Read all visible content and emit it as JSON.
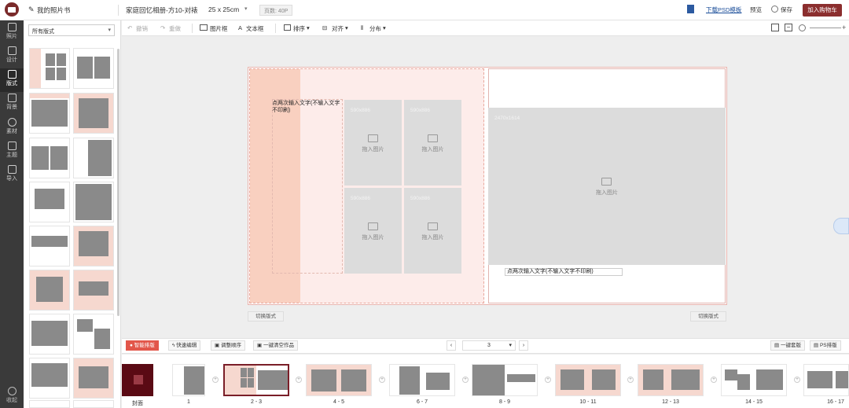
{
  "topbar": {
    "my_book": "我的照片书",
    "book_title": "家庭回忆相册-方10-对裱",
    "book_size": "25 x 25cm",
    "page_count": "页数: 40P",
    "download_psd": "下载PSD模板",
    "preview": "预览",
    "save": "保存",
    "add_to_cart": "加入购物车"
  },
  "leftnav": {
    "items": [
      "照片",
      "设计",
      "版式",
      "背景",
      "素材",
      "主题",
      "导入"
    ],
    "collapse": "收起"
  },
  "panel": {
    "filter_value": "所有版式"
  },
  "toolbar": {
    "undo": "撤销",
    "redo": "重做",
    "photo_frame": "图片框",
    "text_box": "文本框",
    "arrange": "排序",
    "align": "对齐",
    "distribute": "分布"
  },
  "canvas": {
    "left_text": "点两次输入文字(不输入文字不印刷)",
    "right_text": "点两次输入文字(不输入文字不印刷)",
    "photos": [
      {
        "size": "590x886",
        "label": "拖入图片"
      },
      {
        "size": "590x886",
        "label": "拖入图片"
      },
      {
        "size": "590x886",
        "label": "拖入图片"
      },
      {
        "size": "590x886",
        "label": "拖入图片"
      }
    ],
    "big_photo": {
      "size": "2470x1614",
      "label": "拖入图片"
    },
    "switch_layout": "切换版式"
  },
  "bottombar": {
    "smart_layout": "智能排版",
    "quick_edit": "快速编辑",
    "adjust_order": "调整顺序",
    "clear_all": "一键清空作品",
    "current_page": "3",
    "one_key_template": "一键套版",
    "ps_layout": "PS排版"
  },
  "filmstrip": {
    "labels": [
      "封面",
      "1",
      "2 - 3",
      "4 - 5",
      "6 - 7",
      "8 - 9",
      "10 - 11",
      "12 - 13",
      "14 - 15",
      "16 - 17"
    ]
  }
}
